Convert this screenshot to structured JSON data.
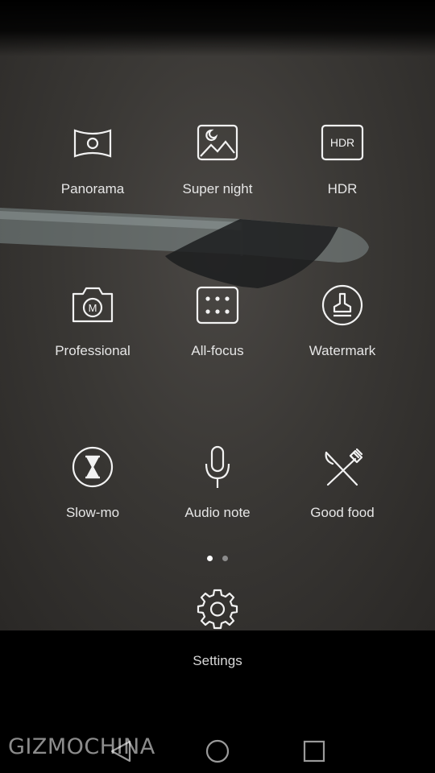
{
  "modes": [
    {
      "label": "Panorama",
      "icon": "panorama-icon"
    },
    {
      "label": "Super night",
      "icon": "moon-landscape-icon"
    },
    {
      "label": "HDR",
      "icon": "hdr-icon",
      "icon_text": "HDR"
    },
    {
      "label": "Professional",
      "icon": "camera-m-icon",
      "icon_text": "M"
    },
    {
      "label": "All-focus",
      "icon": "dots-grid-icon"
    },
    {
      "label": "Watermark",
      "icon": "stamp-icon"
    },
    {
      "label": "Slow-mo",
      "icon": "hourglass-icon"
    },
    {
      "label": "Audio note",
      "icon": "microphone-icon"
    },
    {
      "label": "Good food",
      "icon": "fork-knife-icon"
    }
  ],
  "pager": {
    "pages": 2,
    "active": 1
  },
  "settings": {
    "label": "Settings",
    "icon": "gear-icon"
  },
  "navbar": {
    "buttons": [
      "back-icon",
      "home-icon",
      "recents-icon"
    ]
  },
  "watermark": {
    "text": "GIZMOCHINA"
  },
  "colors": {
    "icon_stroke": "#f2f2f2",
    "label_text": "#e6e6e6",
    "dot_inactive": "#8c8c8c",
    "dot_active": "#ffffff"
  }
}
